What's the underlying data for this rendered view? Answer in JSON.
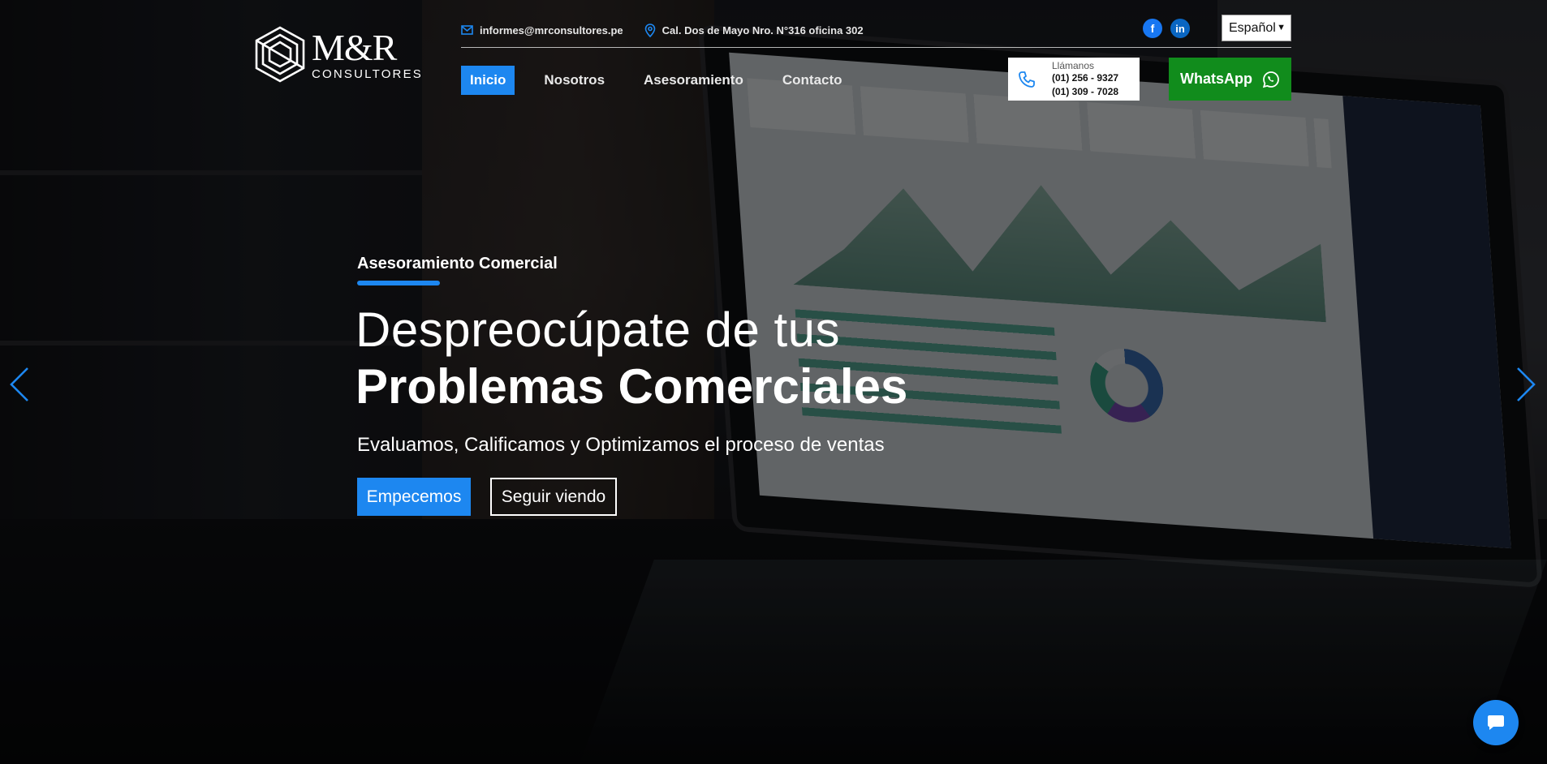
{
  "logo": {
    "brand": "M&R",
    "sub": "CONSULTORES"
  },
  "topbar": {
    "email": "informes@mrconsultores.pe",
    "address": "Cal. Dos de Mayo Nro. N°316 oficina 302",
    "email_icon": "mail-icon",
    "address_icon": "location-pin-icon"
  },
  "socials": [
    {
      "name": "facebook",
      "glyph": "f"
    },
    {
      "name": "linkedin",
      "glyph": "in"
    }
  ],
  "language": {
    "selected": "Español"
  },
  "nav": {
    "items": [
      "Inicio",
      "Nosotros",
      "Asesoramiento",
      "Contacto"
    ],
    "active": "Inicio"
  },
  "call": {
    "label": "Llámanos",
    "phone1": "(01) 256 - 9327",
    "phone2": "(01) 309 - 7028"
  },
  "whatsapp": {
    "label": "WhatsApp"
  },
  "hero": {
    "kicker": "Asesoramiento Comercial",
    "line1": "Despreocúpate de tus",
    "line2": "Problemas Comerciales",
    "sub": "Evaluamos, Calificamos y Optimizamos el proceso de ventas",
    "primary_button": "Empecemos",
    "secondary_button": "Seguir viendo"
  },
  "colors": {
    "accent": "#1d87f0",
    "whatsapp": "#118c1c",
    "facebook": "#1877f2",
    "linkedin": "#0a66c2"
  }
}
